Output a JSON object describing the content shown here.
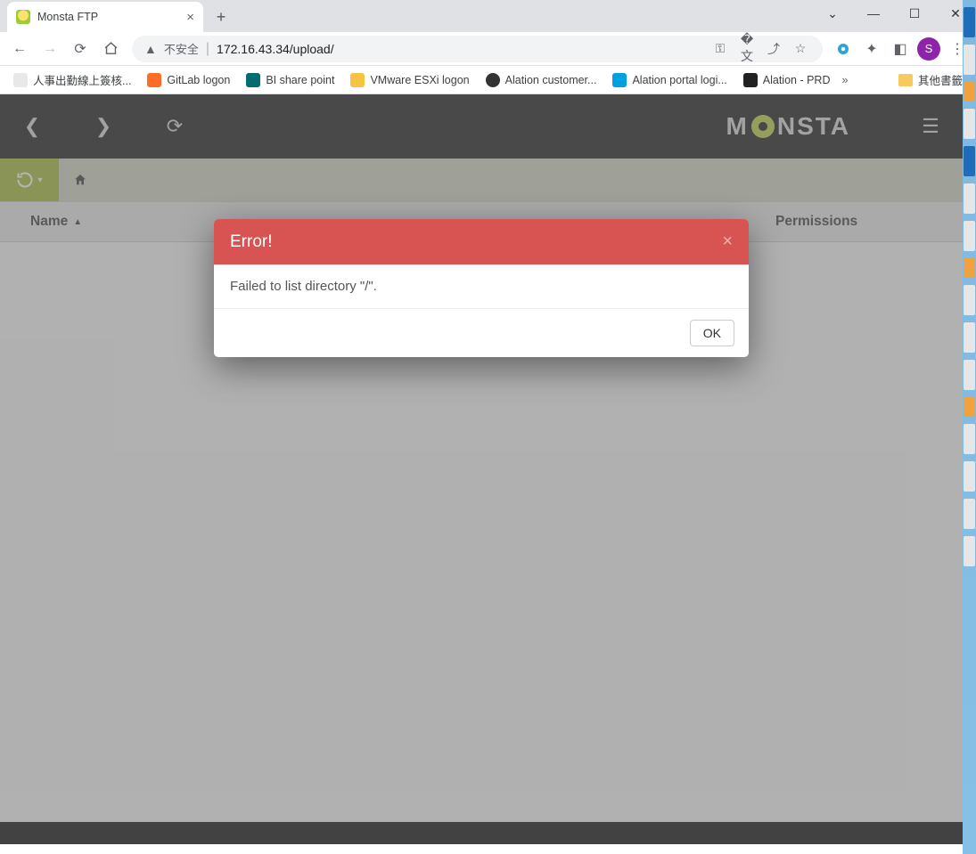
{
  "window": {
    "tab_title": "Monsta FTP",
    "avatar_letter": "S"
  },
  "address": {
    "insecure_label": "不安全",
    "url": "172.16.43.34/upload/"
  },
  "bookmarks": {
    "items": [
      {
        "label": "人事出勤線上簽核..."
      },
      {
        "label": "GitLab logon"
      },
      {
        "label": "BI share point"
      },
      {
        "label": "VMware ESXi logon"
      },
      {
        "label": "Alation customer..."
      },
      {
        "label": "Alation portal logi..."
      },
      {
        "label": "Alation - PRD"
      }
    ],
    "overflow": "»",
    "other": "其他書籤"
  },
  "app": {
    "brand_left": "M",
    "brand_right": "NSTA",
    "columns": {
      "name": "Name",
      "permissions": "Permissions"
    }
  },
  "modal": {
    "title": "Error!",
    "message": "Failed to list directory \"/\".",
    "ok": "OK"
  }
}
